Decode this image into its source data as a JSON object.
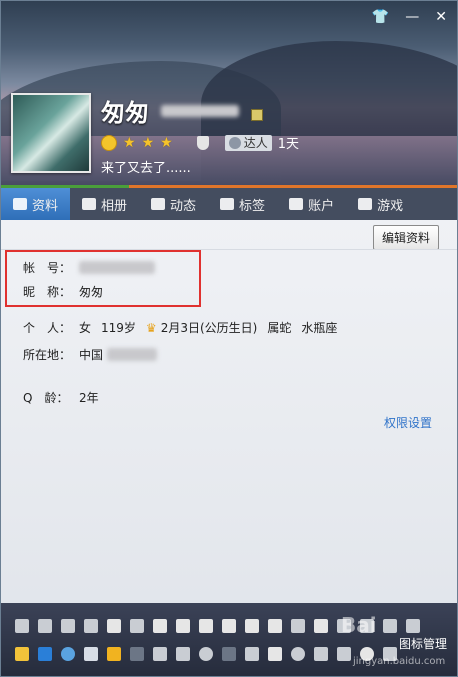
{
  "header": {
    "nickname": "匆匆",
    "days": "1天",
    "talent_badge": "达人",
    "signature": "来了又去了......",
    "icons": {
      "shirt": "shirt-icon",
      "minimize": "minimize-icon",
      "close": "close-icon"
    }
  },
  "tabs": [
    {
      "label": "资料",
      "icon": "profile-card-icon"
    },
    {
      "label": "相册",
      "icon": "photo-album-icon"
    },
    {
      "label": "动态",
      "icon": "feed-list-icon"
    },
    {
      "label": "标签",
      "icon": "bookmark-icon"
    },
    {
      "label": "账户",
      "icon": "wallet-icon"
    },
    {
      "label": "游戏",
      "icon": "game-icon"
    }
  ],
  "main": {
    "edit_button": "编辑资料",
    "account_label": "帐　号：",
    "nickname_label": "昵　称：",
    "nickname_value": "匆匆",
    "personal_label": "个　人：",
    "gender": "女",
    "age": "119岁",
    "birthday": "2月3日(公历生日)",
    "zodiac": "属蛇",
    "constellation": "水瓶座",
    "location_label": "所在地：",
    "location_value": "中国",
    "qage_label": "Q　龄：",
    "qage_value": "2年",
    "permission_link": "权限设置"
  },
  "bottom": {
    "manage_label": "图标管理",
    "watermark": "Bai",
    "watermark_site": "jingyan.baidu.com"
  },
  "colors": {
    "accent": "#2f73c9",
    "highlight_border": "#e0312f",
    "tab_active": "#3f7fc8"
  }
}
